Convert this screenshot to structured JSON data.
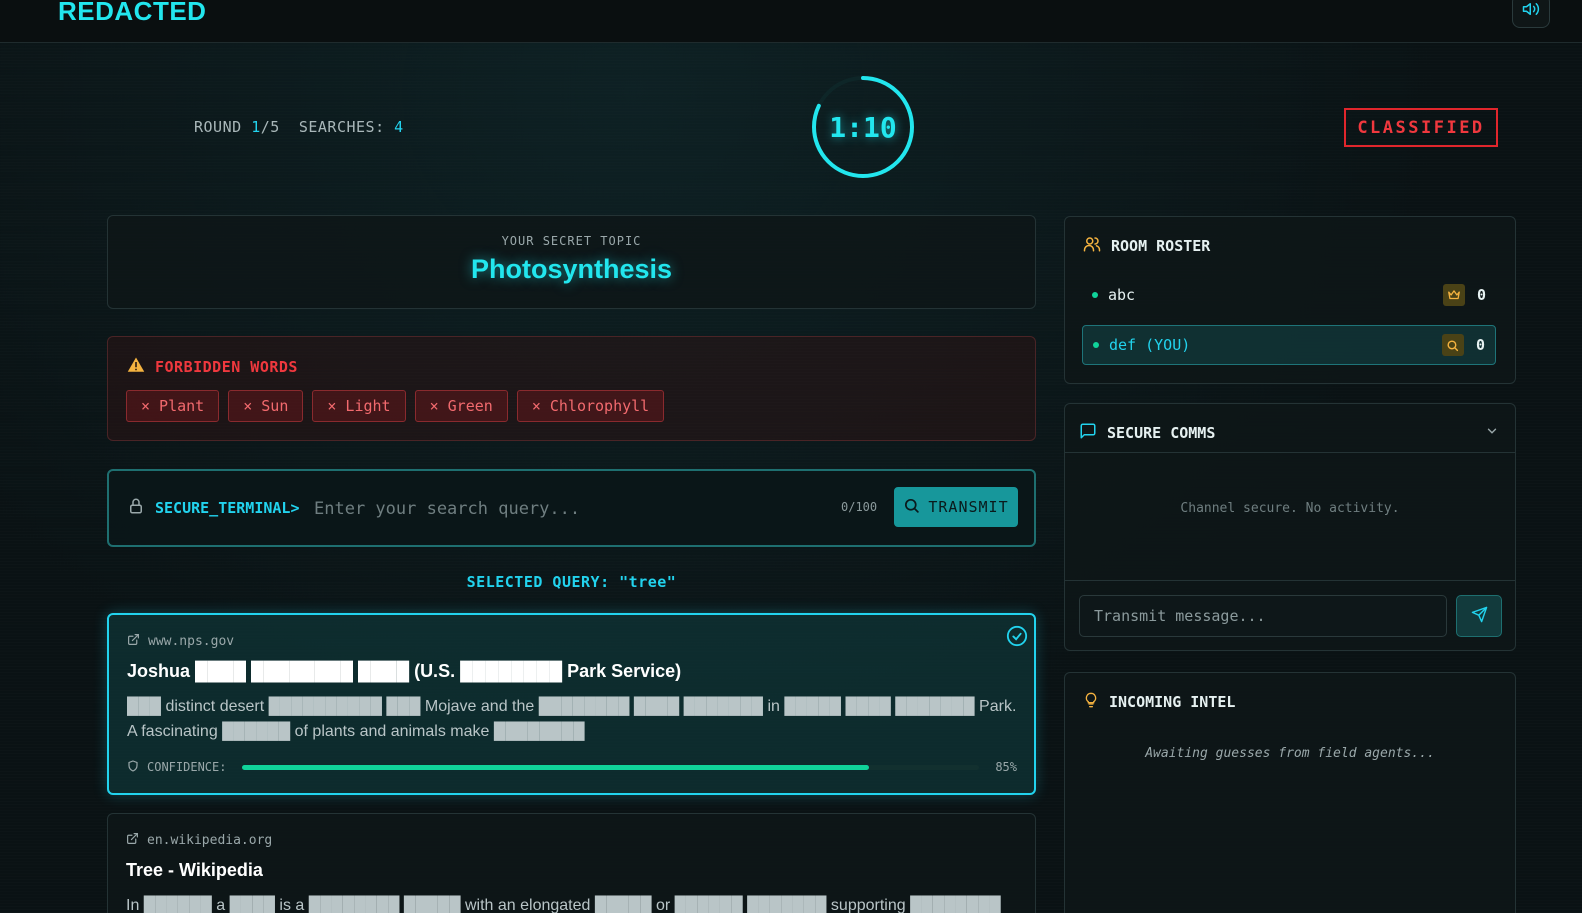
{
  "app": {
    "logo": "REDACTED"
  },
  "status": {
    "round_label": "ROUND",
    "round_current": "1",
    "round_total": "/5",
    "searches_label": "SEARCHES:",
    "searches_value": "4"
  },
  "timer": {
    "value": "1:10",
    "progress": 0.82
  },
  "badge": {
    "label": "CLASSIFIED"
  },
  "topic": {
    "label": "YOUR SECRET TOPIC",
    "value": "Photosynthesis"
  },
  "forbidden": {
    "title": "FORBIDDEN WORDS",
    "words": [
      "× Plant",
      "× Sun",
      "× Light",
      "× Green",
      "× Chlorophyll"
    ]
  },
  "terminal": {
    "prefix": "SECURE_TERMINAL>",
    "placeholder": "Enter your search query...",
    "counter": "0/100",
    "button": "TRANSMIT"
  },
  "selected_query": "SELECTED QUERY: \"tree\"",
  "results": [
    {
      "domain": "www.nps.gov",
      "title": "Joshua ████ ████████ ████ (U.S. ████████ Park Service)",
      "snippet": "███ distinct desert ██████████ ███ Mojave and the ████████ ████ ███████ in █████ ████ ███████ Park. A fascinating ██████ of plants and animals make ████████",
      "confidence_label": "CONFIDENCE:",
      "confidence": 0.85,
      "confidence_text": "85%"
    },
    {
      "domain": "en.wikipedia.org",
      "title": "Tree - Wikipedia",
      "snippet": "In ██████ a ████ is a ████████ █████ with an elongated █████ or ██████ ███████ supporting ████████"
    }
  ],
  "roster": {
    "title": "ROOM ROSTER",
    "players": [
      {
        "name": "abc",
        "score": "0"
      },
      {
        "name": "def (YOU)",
        "score": "0"
      }
    ]
  },
  "comms": {
    "title": "SECURE COMMS",
    "empty": "Channel secure. No activity.",
    "placeholder": "Transmit message..."
  },
  "intel": {
    "title": "INCOMING INTEL",
    "empty": "Awaiting guesses from field agents..."
  },
  "colors": {
    "accent": "#22e6ee",
    "danger": "#f0383e",
    "success": "#10d39a"
  }
}
